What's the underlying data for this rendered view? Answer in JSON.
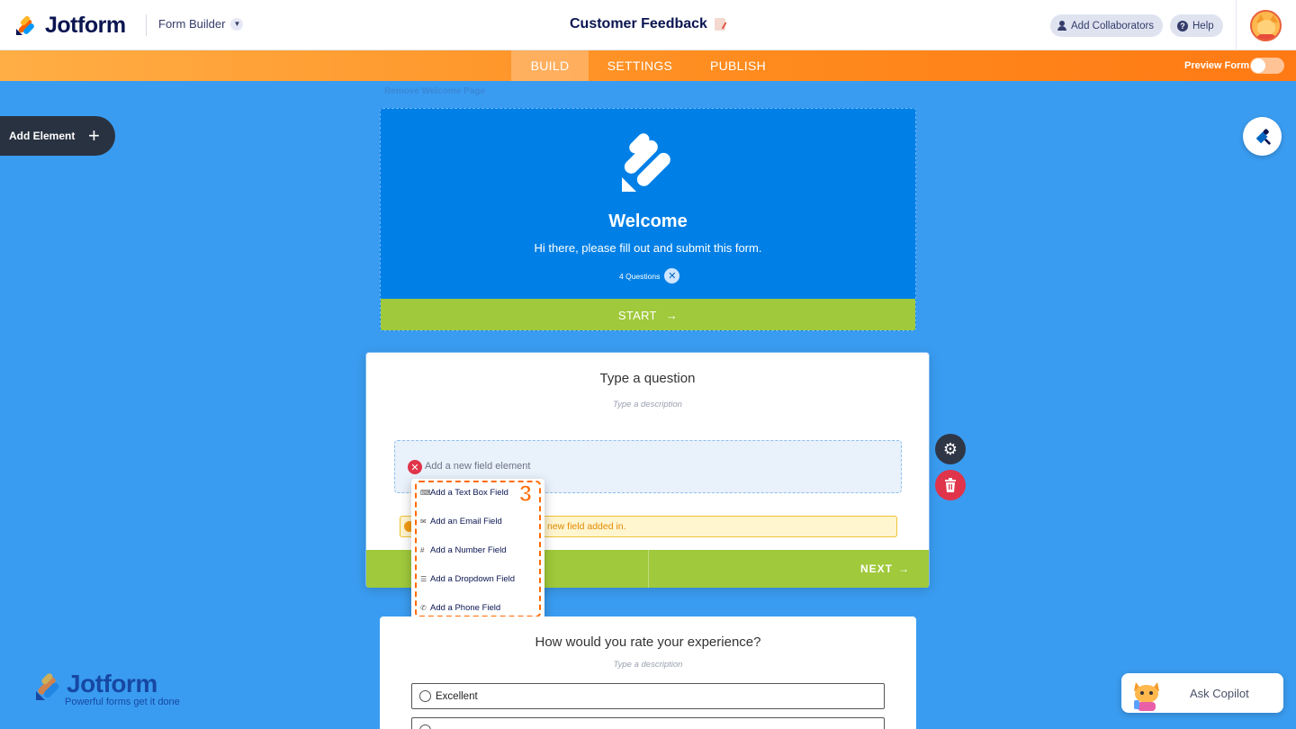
{
  "header": {
    "brand": "Jotform",
    "builder_label": "Form Builder",
    "form_title": "Customer Feedback",
    "collaborators_label": "Add Collaborators",
    "help_label": "Help"
  },
  "nav": {
    "tabs": [
      "BUILD",
      "SETTINGS",
      "PUBLISH"
    ],
    "active_tab": "BUILD",
    "preview_label": "Preview Form",
    "preview_on": false
  },
  "remove_welcome_label": "Remove Welcome Page",
  "sidebar": {
    "add_element_label": "Add Element"
  },
  "welcome": {
    "title": "Welcome",
    "subtitle": "Hi there, please fill out and submit this form.",
    "question_count": "4 Questions",
    "start_label": "START"
  },
  "question_card": {
    "title": "Type a question",
    "description": "Type a description",
    "field_placeholder": "Add a new field element",
    "warning_text": "new field added in.",
    "next_label": "NEXT"
  },
  "field_menu": {
    "items": [
      {
        "icon": "text-box-icon",
        "label": "Add a Text Box Field"
      },
      {
        "icon": "email-icon",
        "label": "Add an Email Field"
      },
      {
        "icon": "number-icon",
        "label": "Add a Number Field"
      },
      {
        "icon": "dropdown-icon",
        "label": "Add a Dropdown Field"
      },
      {
        "icon": "phone-icon",
        "label": "Add a Phone Field"
      }
    ],
    "step_badge": "3"
  },
  "rating_card": {
    "title": "How would you rate your experience?",
    "description": "Type a description",
    "options": [
      "Excellent"
    ]
  },
  "watermark": {
    "brand": "Jotform",
    "tagline": "Powerful forms get it done"
  },
  "copilot": {
    "label": "Ask Copilot"
  },
  "colors": {
    "canvas": "#3a9cf0",
    "nav_orange": "#ff8a1d",
    "welcome_blue": "#0080e6",
    "action_green": "#a0c93b",
    "danger": "#e0344a",
    "highlight": "#ff6a00"
  }
}
